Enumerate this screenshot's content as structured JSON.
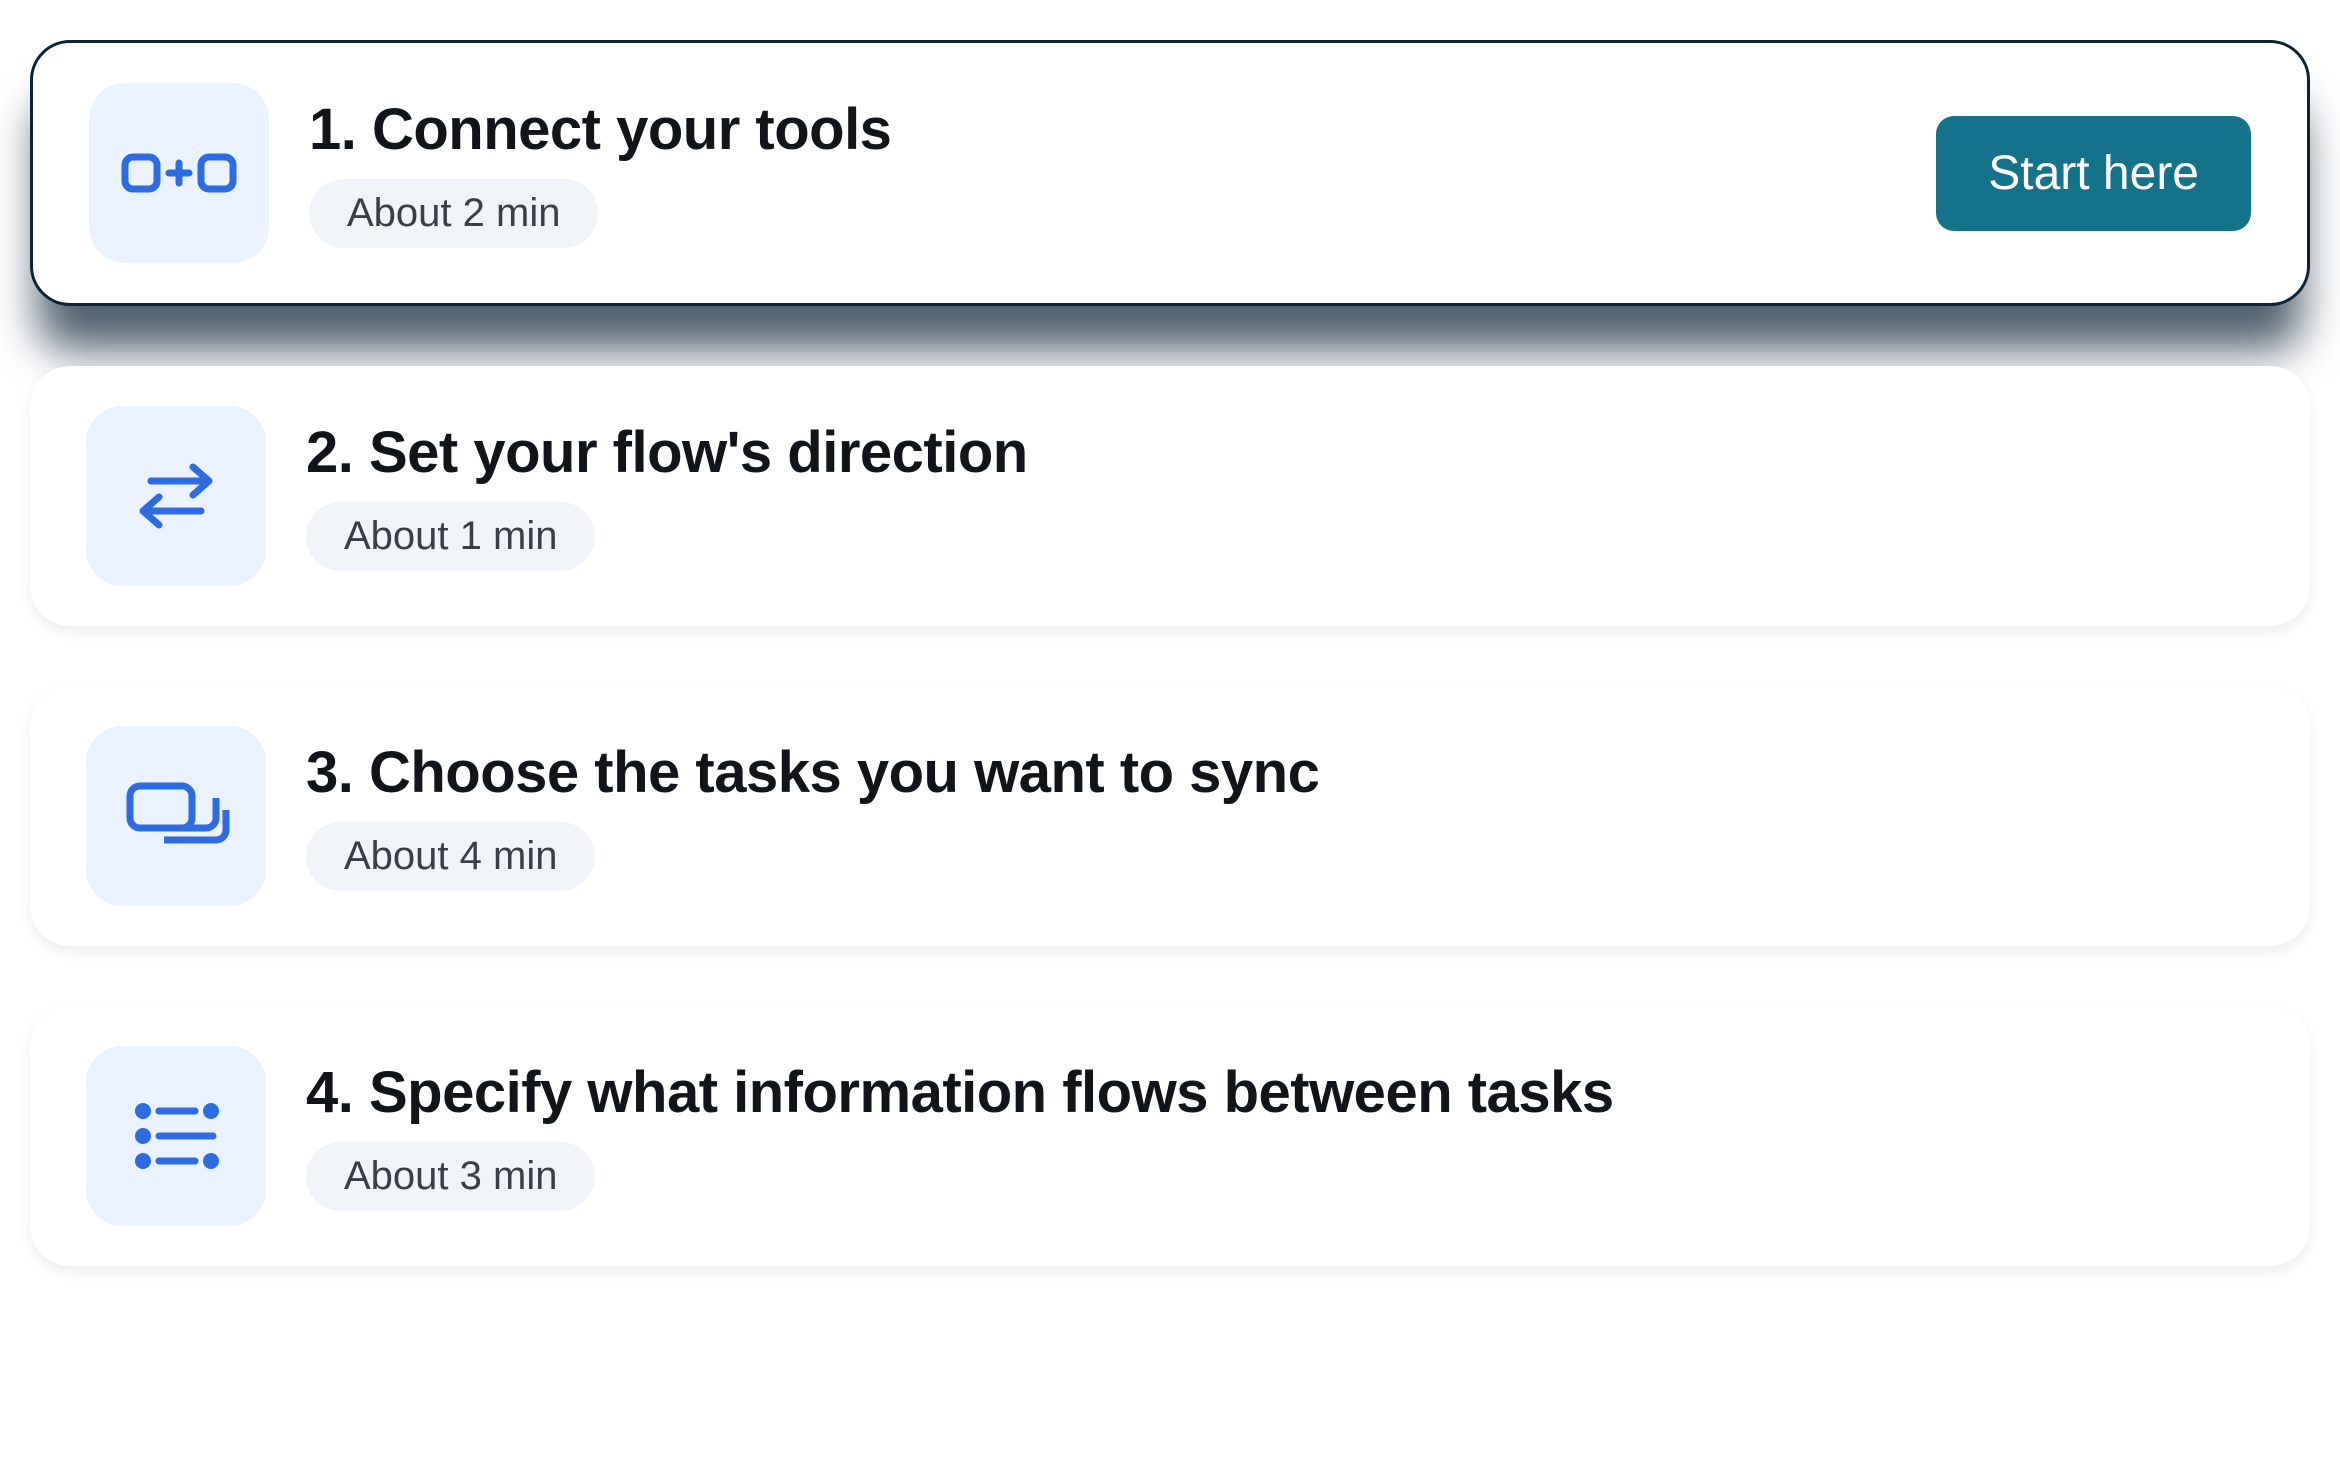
{
  "steps": [
    {
      "title": "1. Connect your tools",
      "duration": "About 2 min",
      "icon": "connect-tools-icon",
      "active": true,
      "cta_label": "Start here"
    },
    {
      "title": "2. Set your flow's direction",
      "duration": "About 1 min",
      "icon": "flow-direction-icon",
      "active": false
    },
    {
      "title": "3. Choose the tasks you want to sync",
      "duration": "About 4 min",
      "icon": "tasks-sync-icon",
      "active": false
    },
    {
      "title": "4. Specify what information flows between tasks",
      "duration": "About 3 min",
      "icon": "information-flow-icon",
      "active": false
    }
  ]
}
